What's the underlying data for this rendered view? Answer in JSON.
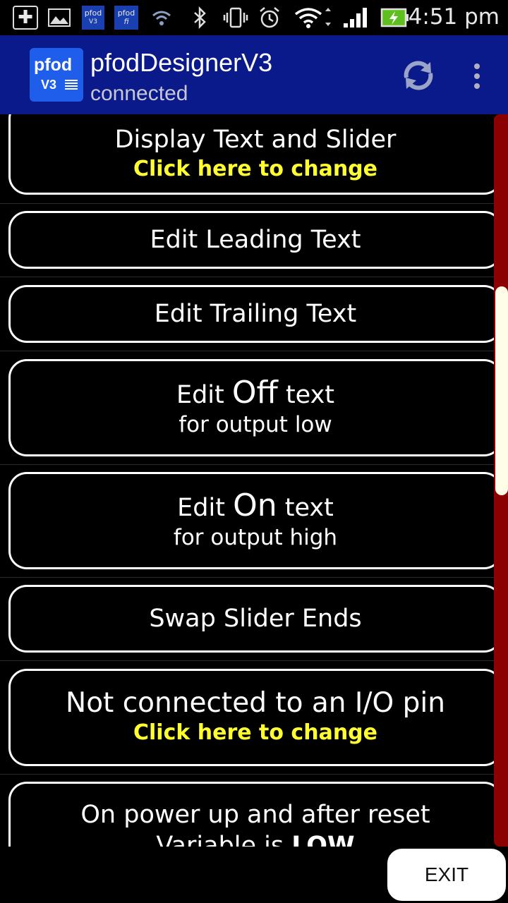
{
  "status_bar": {
    "time": "4:51 pm",
    "icons": [
      "add-notification-icon",
      "image-notification-icon",
      "pfod-v3-notification-icon",
      "pfod-wifi-notification-icon",
      "wifi-small-icon",
      "bluetooth-icon",
      "vibrate-icon",
      "alarm-icon",
      "wifi-icon",
      "signal-icon",
      "battery-charging-icon"
    ],
    "pfod_label": "pfod",
    "v3_label": "V3",
    "fi_label": "fi"
  },
  "action_bar": {
    "logo_line1": "pfod",
    "logo_line2": "V3",
    "title": "pfodDesignerV3",
    "subtitle": "connected",
    "refresh_icon": "refresh-icon",
    "overflow_icon": "overflow-menu-icon",
    "color": "#0a1a8a"
  },
  "items": [
    {
      "main": "Display Text and Slider",
      "sub": "Click here to change"
    },
    {
      "main": "Edit Leading Text"
    },
    {
      "main": "Edit Trailing Text"
    },
    {
      "pre": "Edit ",
      "big": "Off",
      "post": " text",
      "sub": "for output low"
    },
    {
      "pre": "Edit ",
      "big": "On",
      "post": " text",
      "sub": "for output high"
    },
    {
      "main": "Swap Slider Ends"
    },
    {
      "main": "Not connected to an I/O pin",
      "sub": "Click here to change"
    },
    {
      "main": "On power up and after reset",
      "sub_pre": "Variable is ",
      "sub_bold": "LOW"
    }
  ],
  "exit_label": "EXIT",
  "colors": {
    "accent_yellow": "#ffff30",
    "scroll_track": "#8b0000",
    "scroll_thumb": "#fdfde8"
  }
}
